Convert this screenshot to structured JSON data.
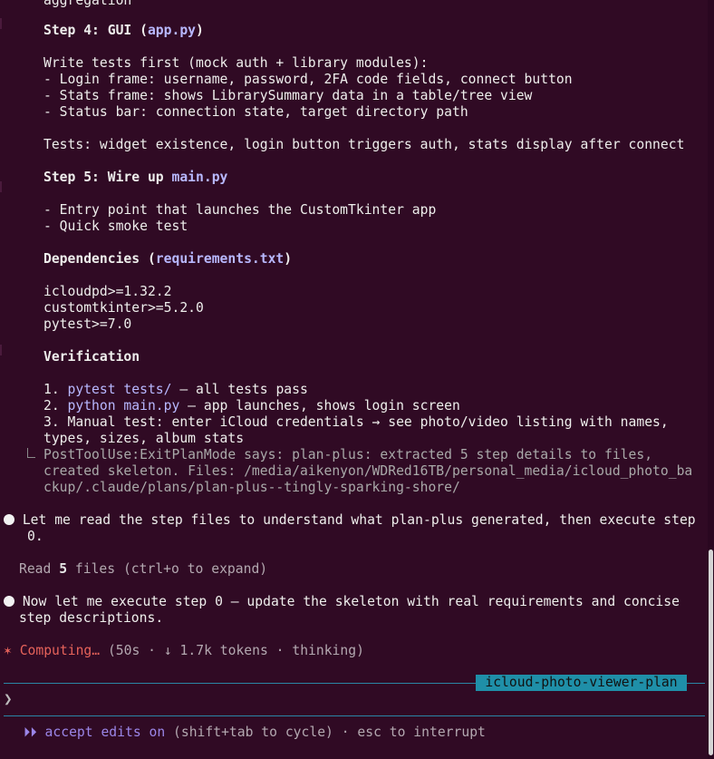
{
  "plan": {
    "l_agg": "aggregation",
    "s4_pre": "Step 4: GUI (",
    "s4_code": "app.py",
    "s4_post": ")",
    "tests_first": "Write tests first (mock auth + library modules):",
    "bullet_login": "- Login frame: username, password, 2FA code fields, connect button",
    "bullet_stats": "- Stats frame: shows LibrarySummary data in a table/tree view",
    "bullet_status": "- Status bar: connection state, target directory path",
    "tests_line": "Tests: widget existence, login button triggers auth, stats display after connect",
    "s5_pre": "Step 5: Wire up ",
    "s5_code": "main.py",
    "bullet_entry": "- Entry point that launches the CustomTkinter app",
    "bullet_smoke": "- Quick smoke test",
    "deps_pre": "Dependencies (",
    "deps_code": "requirements.txt",
    "deps_post": ")",
    "dep1": "icloudpd>=1.32.2",
    "dep2": "customtkinter>=5.2.0",
    "dep3": "pytest>=7.0",
    "verification": "Verification",
    "v1_num": "1. ",
    "v1_code": "pytest tests/",
    "v1_rest": " — all tests pass",
    "v2_num": "2. ",
    "v2_code": "python main.py",
    "v2_rest": " — app launches, shows login screen",
    "v3a": "3. Manual test: enter iCloud credentials → see photo/video listing with names,",
    "v3b": "types, sizes, album stats"
  },
  "hook": {
    "line1": "PostToolUse:ExitPlanMode says: plan-plus: extracted 5 step details to files,",
    "line2": "created skeleton. Files: /media/aikenyon/WDRed16TB/personal_media/icloud_photo_ba",
    "line3": "ckup/.claude/plans/plan-plus--tingly-sparking-shore/"
  },
  "msg1": {
    "line1": "Let me read the step files to understand what plan-plus generated, then execute step",
    "line2": "0."
  },
  "read_tool": {
    "pre": "Read ",
    "count": "5",
    "post": " files (ctrl+o to expand)"
  },
  "msg2": {
    "line1": "Now let me execute step 0 — update the skeleton with real requirements and concise",
    "line2": "step descriptions."
  },
  "status": {
    "spinner": "✶",
    "label": "Computing…",
    "detail": " (50s · ↓ 1.7k tokens · thinking)"
  },
  "session_tag": "icloud-photo-viewer-plan",
  "prompt_char": "❯",
  "mode": {
    "icon": "⏵⏵",
    "label": "accept edits on",
    "hint": " (shift+tab to cycle) · esc to interrupt"
  },
  "colors": {
    "background": "#300a24",
    "code": "#b8b8ff",
    "spinner": "#e5625a",
    "tag_bg": "#1f8fa8",
    "mode": "#9b86e8"
  }
}
